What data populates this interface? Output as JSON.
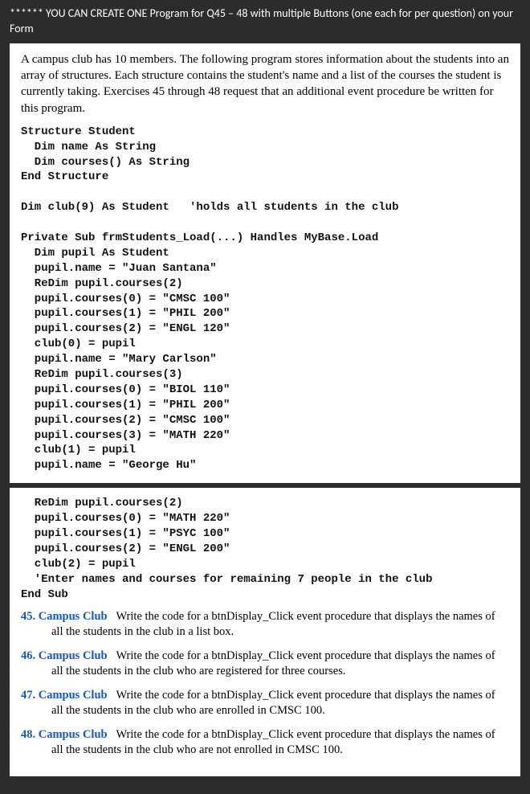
{
  "header_note": "****** YOU CAN CREATE ONE Program for Q45 – 48 with multiple Buttons (one each for per question) on your Form",
  "intro": "A campus club has 10 members. The following program stores information about the students into an array of structures. Each structure contains the student's name and a list of the courses the student is currently taking. Exercises 45 through 48 request that an additional event procedure be written for this program.",
  "code_block_1": "Structure Student\n  Dim name As String\n  Dim courses() As String\nEnd Structure\n\nDim club(9) As Student   'holds all students in the club\n\nPrivate Sub frmStudents_Load(...) Handles MyBase.Load\n  Dim pupil As Student\n  pupil.name = \"Juan Santana\"\n  ReDim pupil.courses(2)\n  pupil.courses(0) = \"CMSC 100\"\n  pupil.courses(1) = \"PHIL 200\"\n  pupil.courses(2) = \"ENGL 120\"\n  club(0) = pupil\n  pupil.name = \"Mary Carlson\"\n  ReDim pupil.courses(3)\n  pupil.courses(0) = \"BIOL 110\"\n  pupil.courses(1) = \"PHIL 200\"\n  pupil.courses(2) = \"CMSC 100\"\n  pupil.courses(3) = \"MATH 220\"\n  club(1) = pupil\n  pupil.name = \"George Hu\"",
  "code_block_2": "  ReDim pupil.courses(2)\n  pupil.courses(0) = \"MATH 220\"\n  pupil.courses(1) = \"PSYC 100\"\n  pupil.courses(2) = \"ENGL 200\"\n  club(2) = pupil\n  'Enter names and courses for remaining 7 people in the club\nEnd Sub",
  "exercises": [
    {
      "num": "45.",
      "title": "Campus Club",
      "body": "Write the code for a btnDisplay_Click event procedure that displays the names of all the students in the club in a list box."
    },
    {
      "num": "46.",
      "title": "Campus Club",
      "body": "Write the code for a btnDisplay_Click event procedure that displays the names of all the students in the club who are registered for three courses."
    },
    {
      "num": "47.",
      "title": "Campus Club",
      "body": "Write the code for a btnDisplay_Click event procedure that displays the names of all the students in the club who are enrolled in CMSC 100."
    },
    {
      "num": "48.",
      "title": "Campus Club",
      "body": "Write the code for a btnDisplay_Click event procedure that displays the names of all the students in the club who are not enrolled in CMSC 100."
    }
  ]
}
